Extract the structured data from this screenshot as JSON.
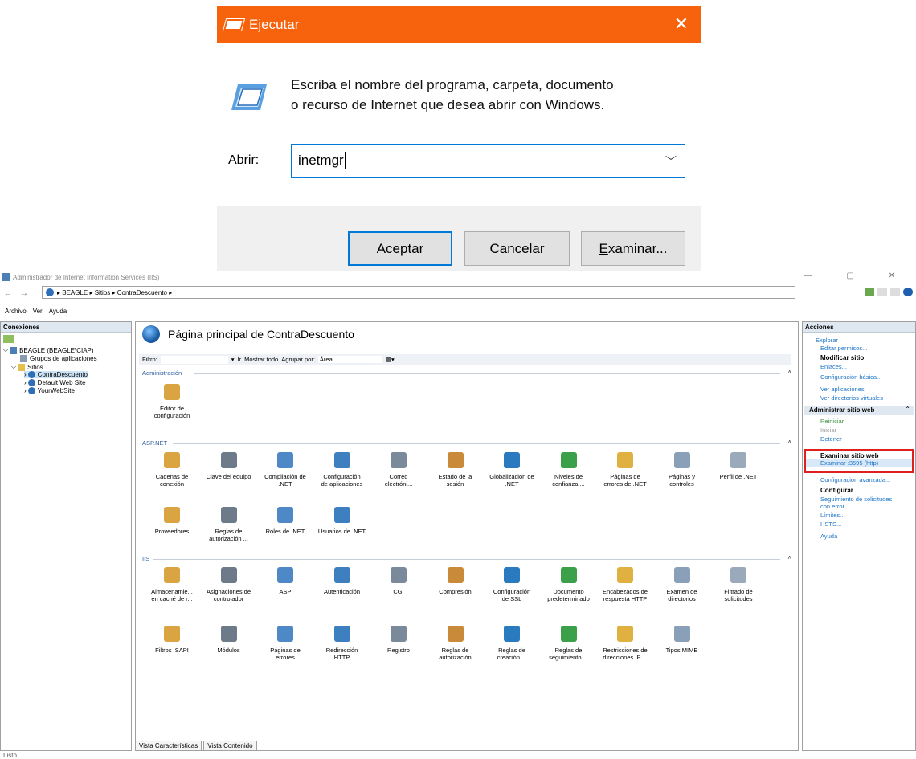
{
  "run": {
    "title": "Ejecutar",
    "close": "✕",
    "message_line1": "Escriba el nombre del programa, carpeta, documento",
    "message_line2": "o recurso de Internet que desea abrir con Windows.",
    "open_label_u": "A",
    "open_label_rest": "brir:",
    "input_value": "inetmgr",
    "ok": "Aceptar",
    "cancel": "Cancelar",
    "browse_u": "E",
    "browse_rest": "xaminar..."
  },
  "iis": {
    "title": "Administrador de Internet Information Services (IIS)",
    "breadcrumb": "▸  BEAGLE  ▸  Sitios  ▸  ContraDescuento  ▸",
    "menu": [
      "Archivo",
      "Ver",
      "Ayuda"
    ],
    "connections": {
      "header": "Conexiones",
      "tree": [
        "BEAGLE (BEAGLE\\CIAP)",
        "Grupos de aplicaciones",
        "Sitios",
        "ContraDescuento",
        "Default Web Site",
        "YourWebSite"
      ]
    },
    "main": {
      "title": "Página principal de ContraDescuento",
      "filter_label": "Filtro:",
      "go": "Ir",
      "show_all": "Mostrar todo",
      "group_by": "Agrupar por:",
      "group_value": "Área",
      "groups": {
        "admin": "Administración",
        "aspnet": "ASP.NET",
        "iis": "IIS"
      },
      "admin_features": [
        "Editor de\nconfiguración"
      ],
      "aspnet_features": [
        "Cadenas de\nconexión",
        "Clave del equipo",
        "Compilación de\n.NET",
        "Configuración\nde aplicaciones",
        "Correo\nelectróni...",
        "Estado de la\nsesión",
        "Globalización de\n.NET",
        "Niveles de\nconfianza ...",
        "Páginas de\nerrores de .NET",
        "Páginas y\ncontroles",
        "Perfil de .NET",
        "Proveedores",
        "Reglas de\nautorización ...",
        "Roles de .NET",
        "Usuarios de .NET"
      ],
      "iis_features": [
        "Almacenamie...\nen caché de r...",
        "Asignaciones de\ncontrolador",
        "ASP",
        "Autenticación",
        "CGI",
        "Compresión",
        "Configuración\nde SSL",
        "Documento\npredeterminado",
        "Encabezados de\nrespuesta HTTP",
        "Examen de\ndirectorios",
        "Filtrado de\nsolicitudes",
        "Filtros ISAPI",
        "Módulos",
        "Páginas de\nerrores",
        "Redirección\nHTTP",
        "Registro",
        "Reglas de\nautorización",
        "Reglas de\ncreación ...",
        "Reglas de\nseguimiento ...",
        "Restricciones de\ndirecciones IP ...",
        "Tipos MIME"
      ],
      "tab_features": "Vista Características",
      "tab_content": "Vista Contenido"
    },
    "actions": {
      "header": "Acciones",
      "explore": "Explorar",
      "edit_perms": "Editar permisos...",
      "modify_site": "Modificar sitio",
      "bindings": "Enlaces...",
      "basic_config": "Configuración básica...",
      "view_apps": "Ver aplicaciones",
      "view_vdirs": "Ver directorios virtuales",
      "manage_site": "Administrar sitio web",
      "restart": "Reiniciar",
      "start": "Iniciar",
      "stop": "Detener",
      "browse_site": "Examinar sitio web",
      "browse_port": "Examinar :3595 (http)",
      "advanced": "Configuración avanzada...",
      "configure": "Configurar",
      "failed_req": "Seguimiento de solicitudes con error...",
      "limits": "Límites...",
      "hsts": "HSTS...",
      "help": "Ayuda"
    },
    "status": "Listo"
  },
  "colors": {
    "run_title": "#f7630c",
    "accent": "#0078d7",
    "link": "#1a73c7",
    "highlight": "#e02020"
  }
}
